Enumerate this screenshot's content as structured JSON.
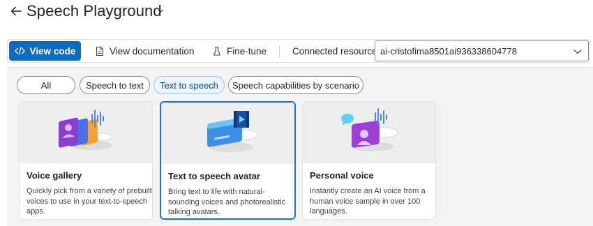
{
  "header": {
    "title": "Speech Playground"
  },
  "toolbar": {
    "view_code": "View code",
    "view_documentation": "View documentation",
    "fine_tune": "Fine-tune",
    "connected_resource_label": "Connected resource",
    "connected_resource_value": "ai-cristofima8501ai936338604778"
  },
  "filters": [
    {
      "label": "All",
      "selected": false
    },
    {
      "label": "Speech to text",
      "selected": false
    },
    {
      "label": "Text to speech",
      "selected": true
    },
    {
      "label": "Speech capabilities by scenario",
      "selected": false
    }
  ],
  "cards": [
    {
      "title": "Voice gallery",
      "description": "Quickly pick from a variety of prebuilt voices to use in your text-to-speech apps.",
      "icon": "voice-gallery-illustration",
      "selected": false
    },
    {
      "title": "Text to speech avatar",
      "description": "Bring text to life with natural-sounding voices and photorealistic talking avatars.",
      "icon": "avatar-illustration",
      "selected": true
    },
    {
      "title": "Personal voice",
      "description": "Instantly create an AI voice from a human voice sample in over 100 languages.",
      "icon": "personal-voice-illustration",
      "selected": false
    }
  ],
  "colors": {
    "primary": "#0f6cbd",
    "selected_border": "#1a73d1",
    "selected_pill_bg": "#ebf3fc"
  }
}
